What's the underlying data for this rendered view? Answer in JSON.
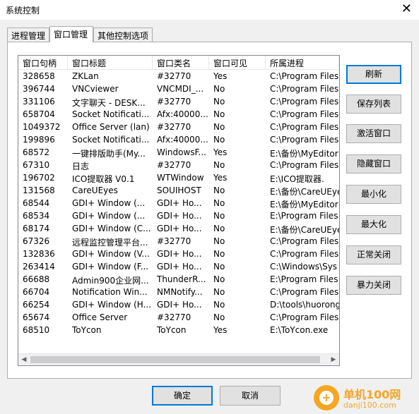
{
  "window": {
    "title": "系统控制",
    "close_glyph": "✕"
  },
  "tabs": [
    {
      "label": "进程管理"
    },
    {
      "label": "窗口管理"
    },
    {
      "label": "其他控制选项"
    }
  ],
  "list": {
    "columns": [
      "窗口句柄",
      "窗口标题",
      "窗口类名",
      "窗口可见",
      "所属进程"
    ],
    "rows": [
      [
        "328658",
        "ZKLan",
        "#32770",
        "Yes",
        "C:\\Program Files"
      ],
      [
        "396744",
        "VNCviewer",
        "VNCMDI_...",
        "No",
        "C:\\Program Files"
      ],
      [
        "331106",
        "文字聊天 - DESK...",
        "#32770",
        "No",
        "C:\\Program Files"
      ],
      [
        "658704",
        "Socket Notificati...",
        "Afx:40000...",
        "No",
        "C:\\Program Files"
      ],
      [
        "1049372",
        "Office Server (lan)",
        "#32770",
        "No",
        "C:\\Program Files"
      ],
      [
        "199896",
        "Socket Notificati...",
        "Afx:40000...",
        "No",
        "C:\\Program Files"
      ],
      [
        "68572",
        "一键排版助手(My...",
        "WindowsF...",
        "Yes",
        "E:\\备份\\MyEditor"
      ],
      [
        "67310",
        "日志",
        "#32770",
        "No",
        "C:\\Program Files"
      ],
      [
        "196702",
        "ICO提取器 V0.1",
        "WTWindow",
        "Yes",
        "E:\\ICO提取器."
      ],
      [
        "131568",
        "CareUEyes",
        "SOUIHOST",
        "No",
        "E:\\备份\\CareUEye"
      ],
      [
        "68544",
        "GDI+ Window (...",
        "GDI+ Ho...",
        "No",
        "E:\\备份\\MyEditor"
      ],
      [
        "68534",
        "GDI+ Window (...",
        "GDI+ Ho...",
        "No",
        "E:\\Program Files"
      ],
      [
        "68174",
        "GDI+ Window (C...",
        "GDI+ Ho...",
        "No",
        "E:\\备份\\CareUEye"
      ],
      [
        "67326",
        "远程监控管理平台...",
        "#32770",
        "No",
        "C:\\Program Files"
      ],
      [
        "132836",
        "GDI+ Window (V...",
        "GDI+ Ho...",
        "No",
        "C:\\Program Files"
      ],
      [
        "263414",
        "GDI+ Window (F...",
        "GDI+ Ho...",
        "No",
        "C:\\Windows\\Sys"
      ],
      [
        "66688",
        "Admin900企业网...",
        "ThunderR...",
        "No",
        "E:\\Program Files"
      ],
      [
        "66704",
        "Notification Win...",
        "NMNotify...",
        "No",
        "C:\\Program Files"
      ],
      [
        "66254",
        "GDI+ Window (H...",
        "GDI+ Ho...",
        "No",
        "D:\\tools\\huorong"
      ],
      [
        "65674",
        "Office Server",
        "#32770",
        "No",
        "C:\\Program Files"
      ],
      [
        "68510",
        "ToYcon",
        "ToYcon",
        "Yes",
        "E:\\ToYcon.exe"
      ]
    ]
  },
  "side_buttons": [
    "刷新",
    "保存列表",
    "激活窗口",
    "隐藏窗口",
    "最小化",
    "最大化",
    "正常关闭",
    "暴力关闭"
  ],
  "bottom_buttons": {
    "ok": "确定",
    "cancel": "取消"
  },
  "scroll": {
    "left_glyph": "◀",
    "right_glyph": "▶"
  },
  "watermark": {
    "name": "单机100网",
    "url": "danji100.com"
  },
  "colors": {
    "accent": "#0078d7",
    "watermark": "#f5a623"
  }
}
